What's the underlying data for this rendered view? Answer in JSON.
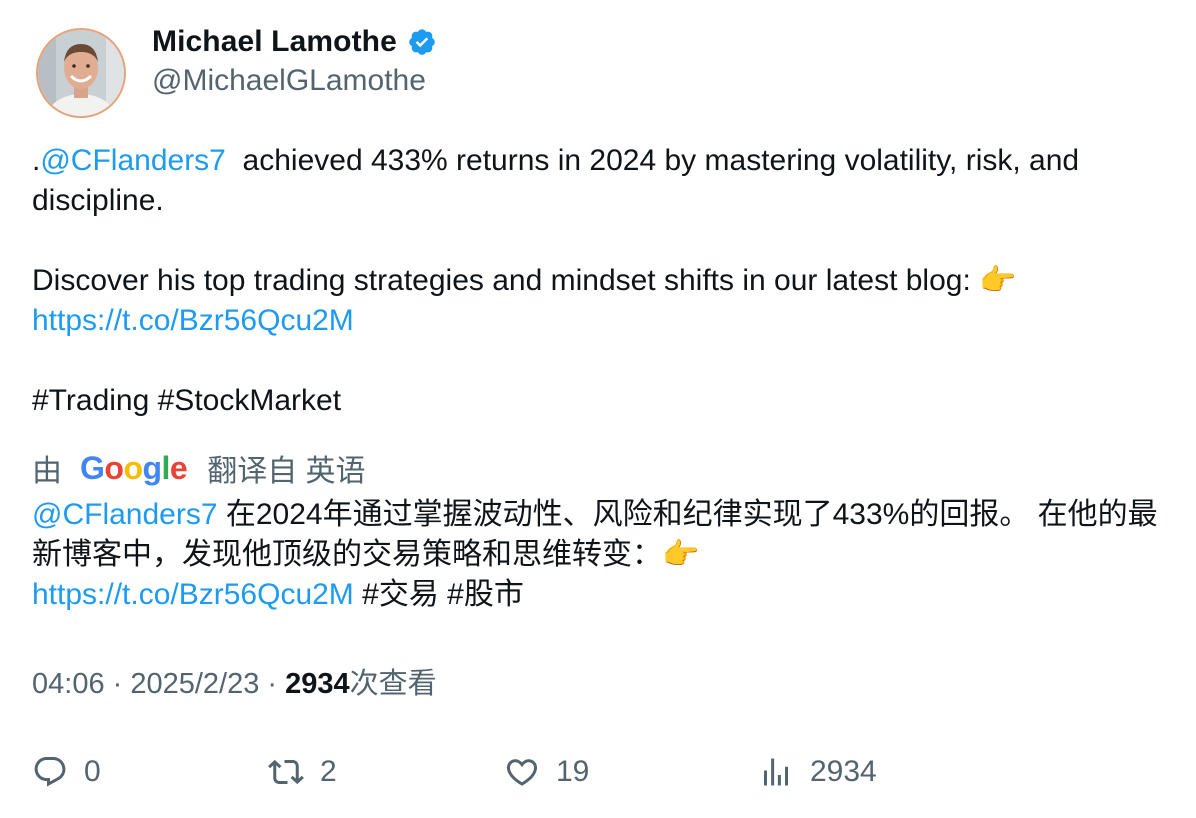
{
  "author": {
    "display_name": "Michael Lamothe",
    "handle": "@MichaelGLamothe",
    "verified": true,
    "avatar": "avatar-photo"
  },
  "tweet": {
    "line1_prefix": ".",
    "mention": "@CFlanders7",
    "line1_rest": "  achieved 433% returns in 2024 by mastering volatility, risk, and discipline.",
    "line2": "Discover his top trading strategies and mindset shifts in our latest blog: 👉",
    "link": "https://t.co/Bzr56Qcu2M",
    "hashtags": "#Trading #StockMarket"
  },
  "translation": {
    "prefix": "由",
    "provider_letters": [
      "G",
      "o",
      "o",
      "g",
      "l",
      "e"
    ],
    "suffix": "翻译自 英语",
    "mention": "@CFlanders7",
    "text": " 在2024年通过掌握波动性、风险和纪律实现了433%的回报。 在他的最新博客中，发现他顶级的交易策略和思维转变：👉",
    "link": "https://t.co/Bzr56Qcu2M",
    "hashtags": " #交易 #股市"
  },
  "meta": {
    "time": "04:06",
    "sep1": " · ",
    "date": "2025/2/23",
    "sep2": " · ",
    "views_count": "2934",
    "views_label": "次查看"
  },
  "actions": {
    "reply_count": "0",
    "retweet_count": "2",
    "like_count": "19",
    "views_count": "2934"
  },
  "colors": {
    "link": "#1d9bf0",
    "secondary_text": "#536471",
    "primary_text": "#0f1419",
    "verified_badge": "#1d9bf0"
  }
}
